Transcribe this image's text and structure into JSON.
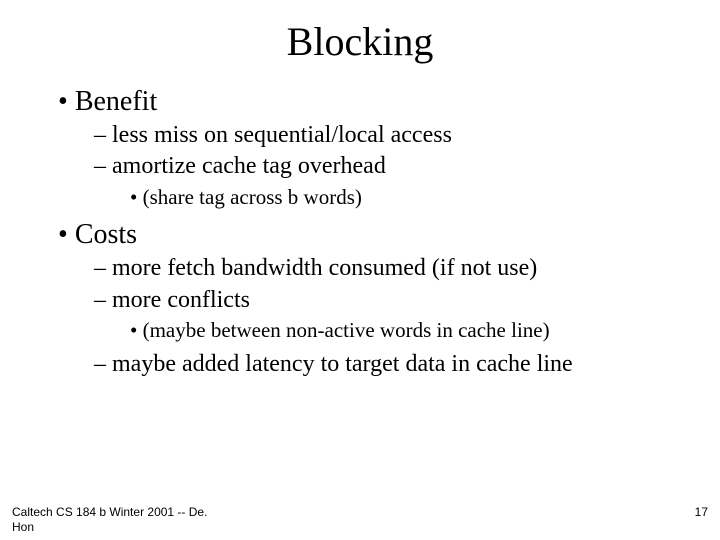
{
  "title": "Blocking",
  "bullets": {
    "benefit": {
      "label": "Benefit",
      "sub1": "less miss on sequential/local access",
      "sub2": "amortize cache tag overhead",
      "sub2_detail": "(share tag across b words)"
    },
    "costs": {
      "label": "Costs",
      "sub1": "more fetch bandwidth consumed (if not use)",
      "sub2": "more conflicts",
      "sub2_detail": "(maybe between non-active words in cache line)",
      "sub3": "maybe added latency to target data in cache line"
    }
  },
  "footer": {
    "left": "Caltech CS 184 b Winter 2001 -- De. Hon",
    "page": "17"
  }
}
